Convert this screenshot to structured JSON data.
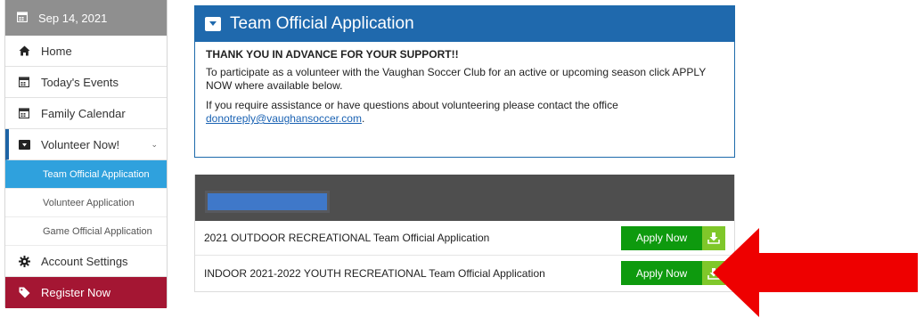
{
  "sidebar": {
    "date": "Sep 14, 2021",
    "items": [
      {
        "label": "Home"
      },
      {
        "label": "Today's Events"
      },
      {
        "label": "Family Calendar"
      },
      {
        "label": "Volunteer Now!"
      }
    ],
    "subitems": [
      {
        "label": "Team Official Application"
      },
      {
        "label": "Volunteer Application"
      },
      {
        "label": "Game Official Application"
      }
    ],
    "account": "Account Settings",
    "register": "Register Now"
  },
  "panel": {
    "title": "Team Official Application",
    "thanks": "THANK YOU IN ADVANCE FOR YOUR SUPPORT!!",
    "para1": "To participate as a volunteer with the Vaughan Soccer Club for an active or upcoming season click APPLY NOW where available below.",
    "para2": "If you require assistance or have questions about volunteering please contact the office",
    "email": "donotreply@vaughansoccer.com",
    "email_suffix": "."
  },
  "applications": {
    "rows": [
      {
        "name": "2021 OUTDOOR RECREATIONAL Team Official Application",
        "button": "Apply Now"
      },
      {
        "name": "INDOOR 2021-2022 YOUTH RECREATIONAL Team Official Application",
        "button": "Apply Now"
      }
    ]
  },
  "colors": {
    "header_blue": "#1f69ad",
    "active_sub": "#2fa1dd",
    "register": "#a41633",
    "apply_green": "#0e9a0e",
    "apply_icon": "#7fc72a",
    "arrow": "#ee0000"
  },
  "icons": {
    "date": "calendar-icon",
    "home": "home-icon",
    "events": "calendar-icon",
    "family": "calendar-icon",
    "volunteer": "download-box-icon",
    "account": "gear-icon",
    "register": "tag-icon",
    "apply": "download-icon"
  }
}
